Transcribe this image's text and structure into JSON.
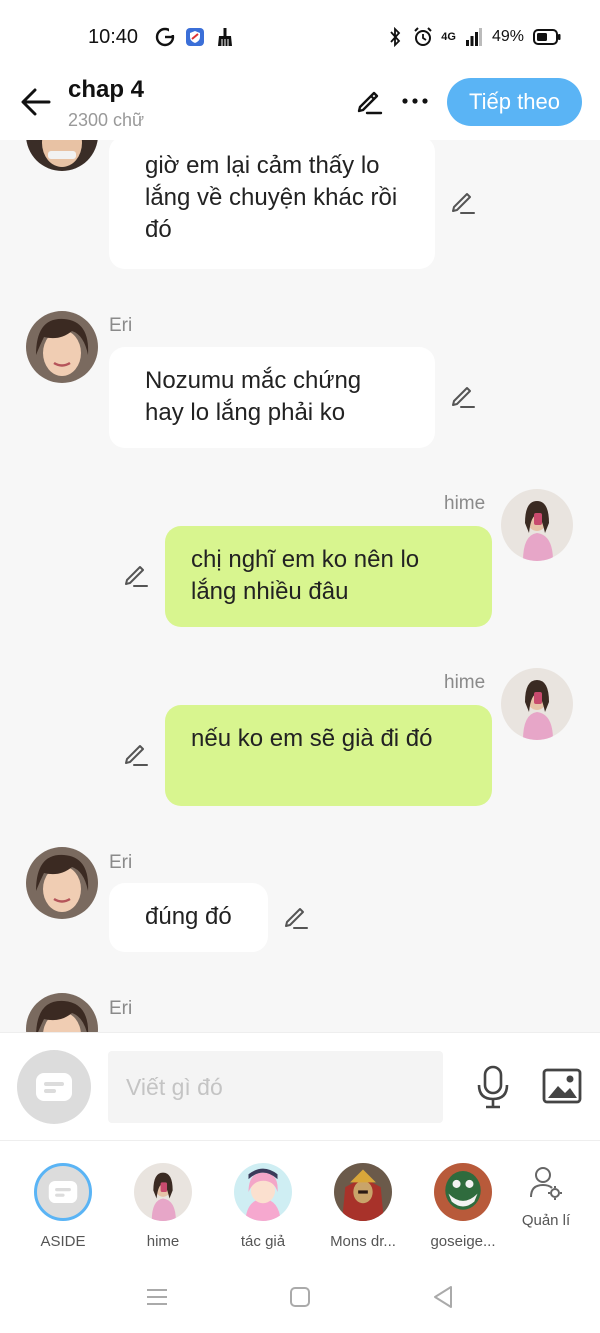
{
  "status": {
    "time": "10:40",
    "network": "4G",
    "battery": "49%"
  },
  "header": {
    "title": "chap 4",
    "word_count": "2300 chữ",
    "next_label": "Tiếp theo"
  },
  "messages": [
    {
      "speaker": "",
      "side": "left",
      "avatar": "boy",
      "text": "giờ em lại cảm thấy lo lắng về chuyện khác rồi đó"
    },
    {
      "speaker": "Eri",
      "side": "left",
      "avatar": "eri",
      "text": "Nozumu mắc chứng hay lo lắng phải ko"
    },
    {
      "speaker": "hime",
      "side": "right",
      "avatar": "hime",
      "text": "chị nghĩ em ko nên lo lắng nhiều đâu"
    },
    {
      "speaker": "hime",
      "side": "right",
      "avatar": "hime",
      "text": "nếu ko em sẽ già đi đó"
    },
    {
      "speaker": "Eri",
      "side": "left",
      "avatar": "eri",
      "text": "đúng đó"
    },
    {
      "speaker": "Eri",
      "side": "left",
      "avatar": "eri",
      "text": ""
    }
  ],
  "composer": {
    "placeholder": "Viết gì đó"
  },
  "characters": [
    {
      "name": "ASIDE"
    },
    {
      "name": "hime"
    },
    {
      "name": "tác giả"
    },
    {
      "name": "Mons dr..."
    },
    {
      "name": "goseige..."
    }
  ],
  "manage_label": "Quản lí",
  "colors": {
    "accent": "#5ab4f5",
    "right_bubble": "#d8f58f",
    "left_bubble": "#ffffff",
    "background": "#f7f7f7"
  }
}
